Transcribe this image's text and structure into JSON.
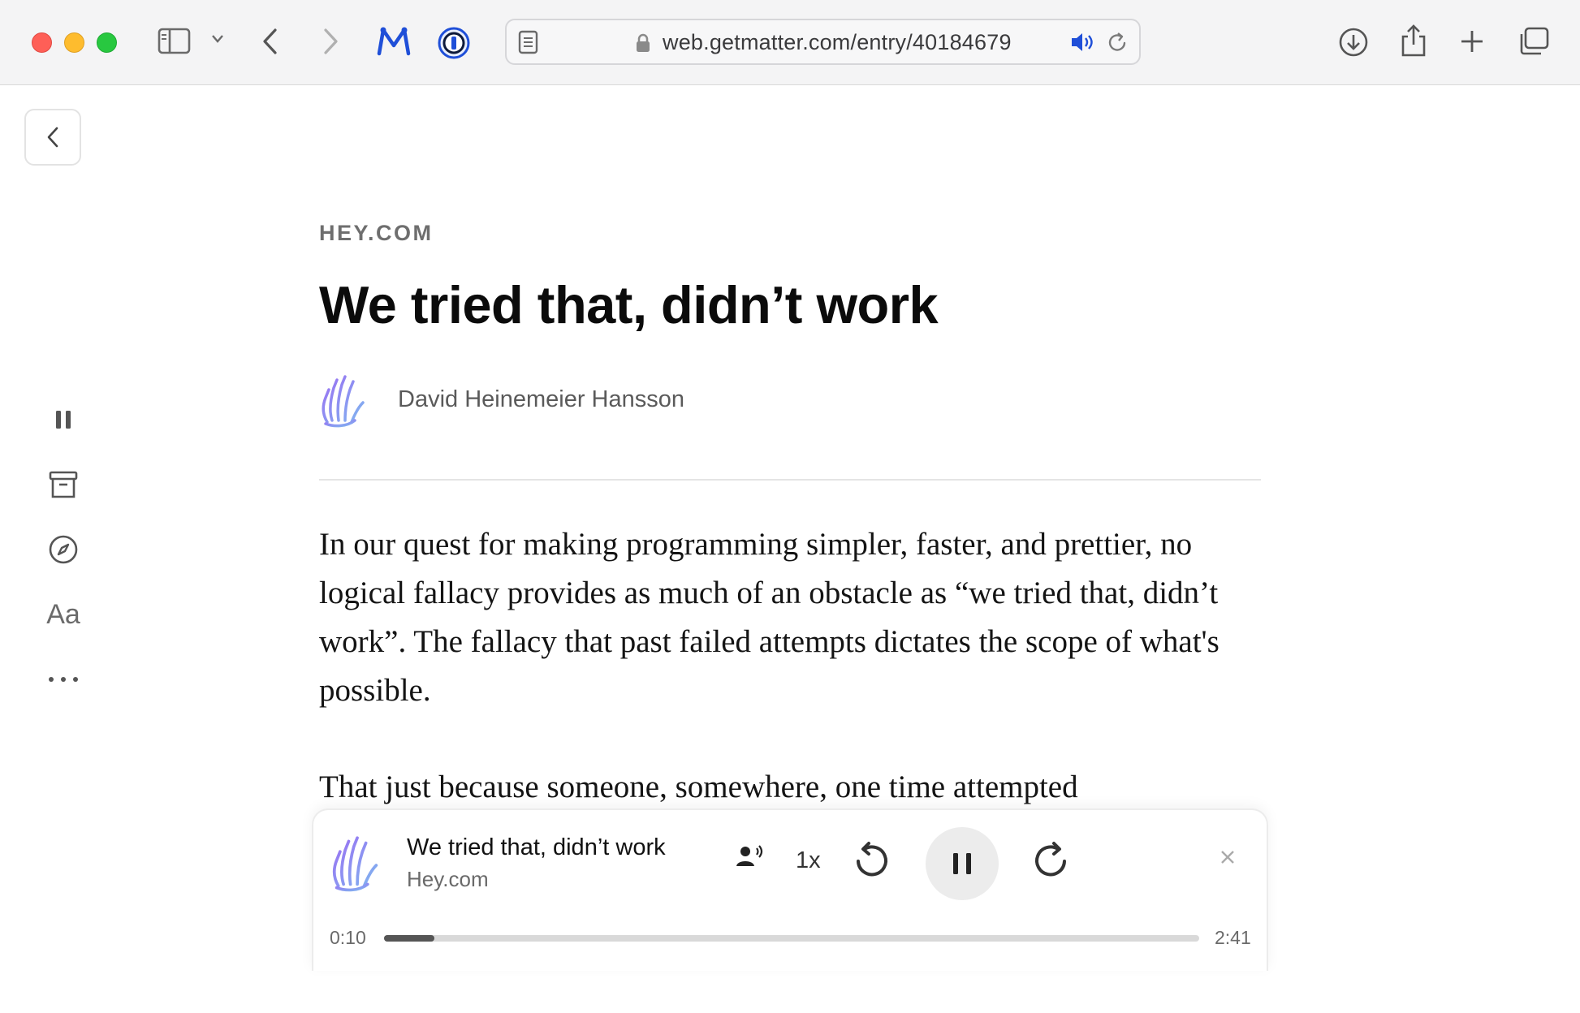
{
  "browser": {
    "url": "web.getmatter.com/entry/40184679"
  },
  "rail": {
    "typography_label": "Aa"
  },
  "article": {
    "source": "HEY.COM",
    "title": "We tried that, didn’t work",
    "author": "David Heinemeier Hansson",
    "paragraphs": [
      "In our quest for making programming simpler, faster, and prettier, no logical fallacy provides as much of an obstacle as “we tried that, didn’t work”. The fallacy that past failed attempts dictates the scope of what's possible.",
      "That just because someone, somewhere, one time attempted"
    ]
  },
  "player": {
    "title": "We tried that, didn’t work",
    "source": "Hey.com",
    "speed": "1x",
    "elapsed": "0:10",
    "duration": "2:41",
    "progress_fraction": 0.062
  },
  "colors": {
    "accent_blue": "#1f4fd8",
    "text": "#111111",
    "muted": "#6a6a6a"
  }
}
